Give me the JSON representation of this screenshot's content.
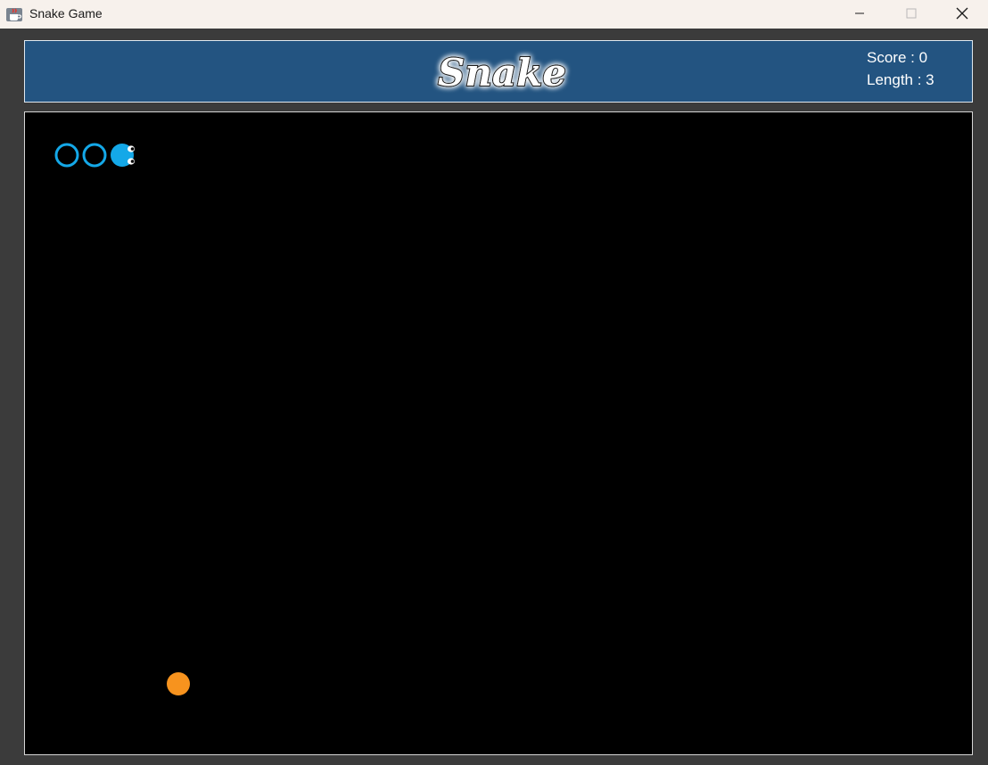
{
  "window": {
    "title": "Snake Game",
    "icon": "java-cup-icon",
    "controls": [
      "minimize-icon",
      "maximize-icon",
      "close-icon"
    ]
  },
  "header": {
    "logo_text": "Snake",
    "score_label": "Score : 0",
    "length_label": "Length : 3",
    "background_color": "#235481"
  },
  "game": {
    "score": 0,
    "length": 3,
    "board_color": "#000000",
    "snake_color": "#14a8e8",
    "snake_head_direction": "right",
    "food_color": "#f7931e"
  }
}
